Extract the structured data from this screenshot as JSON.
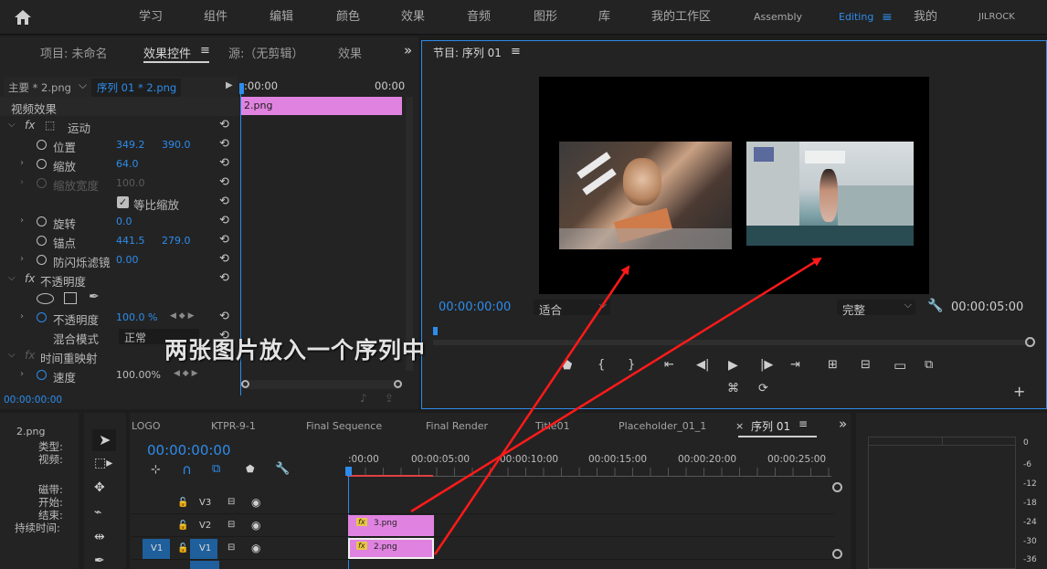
{
  "menu": {
    "home_icon": "home-icon",
    "items": [
      "学习",
      "组件",
      "编辑",
      "颜色",
      "效果",
      "音频",
      "图形",
      "库",
      "我的工作区",
      "Assembly",
      "Editing",
      "我的",
      "JILROCK"
    ],
    "active": "Editing",
    "menu_icon": "hamburger-icon"
  },
  "left_tabs": {
    "project": "项目: 未命名",
    "effect_controls": "效果控件",
    "source": "源:（无剪辑）",
    "effects": "效果",
    "more": "»"
  },
  "effect_controls": {
    "master": "主要 * 2.png",
    "sequence_clip": "序列 01 * 2.png",
    "time_start": ":00:00",
    "time_end": "00:00",
    "clip_label": "2.png",
    "video_effects": "视频效果",
    "motion": "运动",
    "position_label": "位置",
    "position_x": "349.2",
    "position_y": "390.0",
    "scale_label": "缩放",
    "scale_value": "64.0",
    "scale_width_label": "缩放宽度",
    "scale_width_value": "100.0",
    "uniform_scale": "等比缩放",
    "rotation_label": "旋转",
    "rotation_value": "0.0",
    "anchor_label": "锚点",
    "anchor_x": "441.5",
    "anchor_y": "279.0",
    "antiflicker_label": "防闪烁滤镜",
    "antiflicker_value": "0.00",
    "opacity_section": "不透明度",
    "opacity_label": "不透明度",
    "opacity_value": "100.0 %",
    "blend_label": "混合模式",
    "blend_value": "正常",
    "time_remap": "时间重映射",
    "speed_label": "速度",
    "speed_value": "100.00%",
    "timecode": "00:00:00:00",
    "fx": "fx"
  },
  "program": {
    "title": "节目: 序列 01",
    "timecode": "00:00:00:00",
    "fit": "适合",
    "quality": "完整",
    "duration": "00:00:05:00",
    "overlay_text": "两张图片放入一个序列中",
    "add": "+"
  },
  "project_info": {
    "name": "2.png",
    "type_label": "类型:",
    "video_label": "视频:",
    "tape_label": "磁带:",
    "start_label": "开始:",
    "end_label": "结束:",
    "duration_label": "持续时间:"
  },
  "timeline": {
    "tabs": [
      "LOGO",
      "KTPR-9-1",
      "Final Sequence",
      "Final Render",
      "Title01",
      "Placeholder_01_1"
    ],
    "active_tab": "序列 01",
    "close": "×",
    "timecode": "00:00:00:00",
    "ruler": [
      ":00:00",
      "00:00:05:00",
      "00:00:10:00",
      "00:00:15:00",
      "00:00:20:00",
      "00:00:25:00"
    ],
    "tracks": [
      "V3",
      "V2",
      "V1"
    ],
    "source_track": "V1",
    "clips": [
      {
        "name": "3.png",
        "track": "V2"
      },
      {
        "name": "2.png",
        "track": "V1"
      }
    ]
  },
  "meter": {
    "ticks": [
      "0",
      "-6",
      "-12",
      "-18",
      "-24",
      "-30",
      "-36"
    ]
  },
  "colors": {
    "accent": "#2d8ceb",
    "clip": "#e083e0",
    "annotation": "#ff1a1a",
    "panel": "#232323"
  }
}
